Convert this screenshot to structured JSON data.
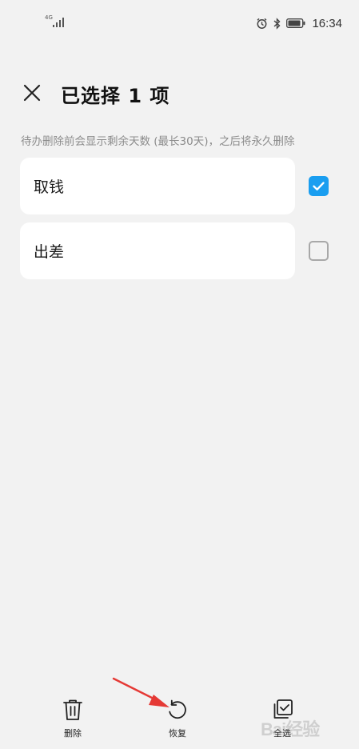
{
  "status_bar": {
    "network_label": "4G",
    "time": "16:34",
    "icons": [
      "alarm-icon",
      "bluetooth-icon",
      "battery-icon"
    ]
  },
  "header": {
    "close_icon": "close-icon",
    "title": "已选择 1 项"
  },
  "hint": "待办删除前会显示剩余天数 (最长30天)，之后将永久删除",
  "items": [
    {
      "label": "取钱",
      "checked": true
    },
    {
      "label": "出差",
      "checked": false
    }
  ],
  "bottom_bar": {
    "actions": [
      {
        "label": "删除",
        "icon": "trash-icon"
      },
      {
        "label": "恢复",
        "icon": "restore-icon"
      },
      {
        "label": "全选",
        "icon": "select-all-icon"
      }
    ]
  },
  "watermark": {
    "text": "Bai经验"
  },
  "colors": {
    "background": "#f2f2f2",
    "card": "#ffffff",
    "accent": "#1a9ef0",
    "hint": "#8c8c8c",
    "annotation_arrow": "#e53935"
  }
}
